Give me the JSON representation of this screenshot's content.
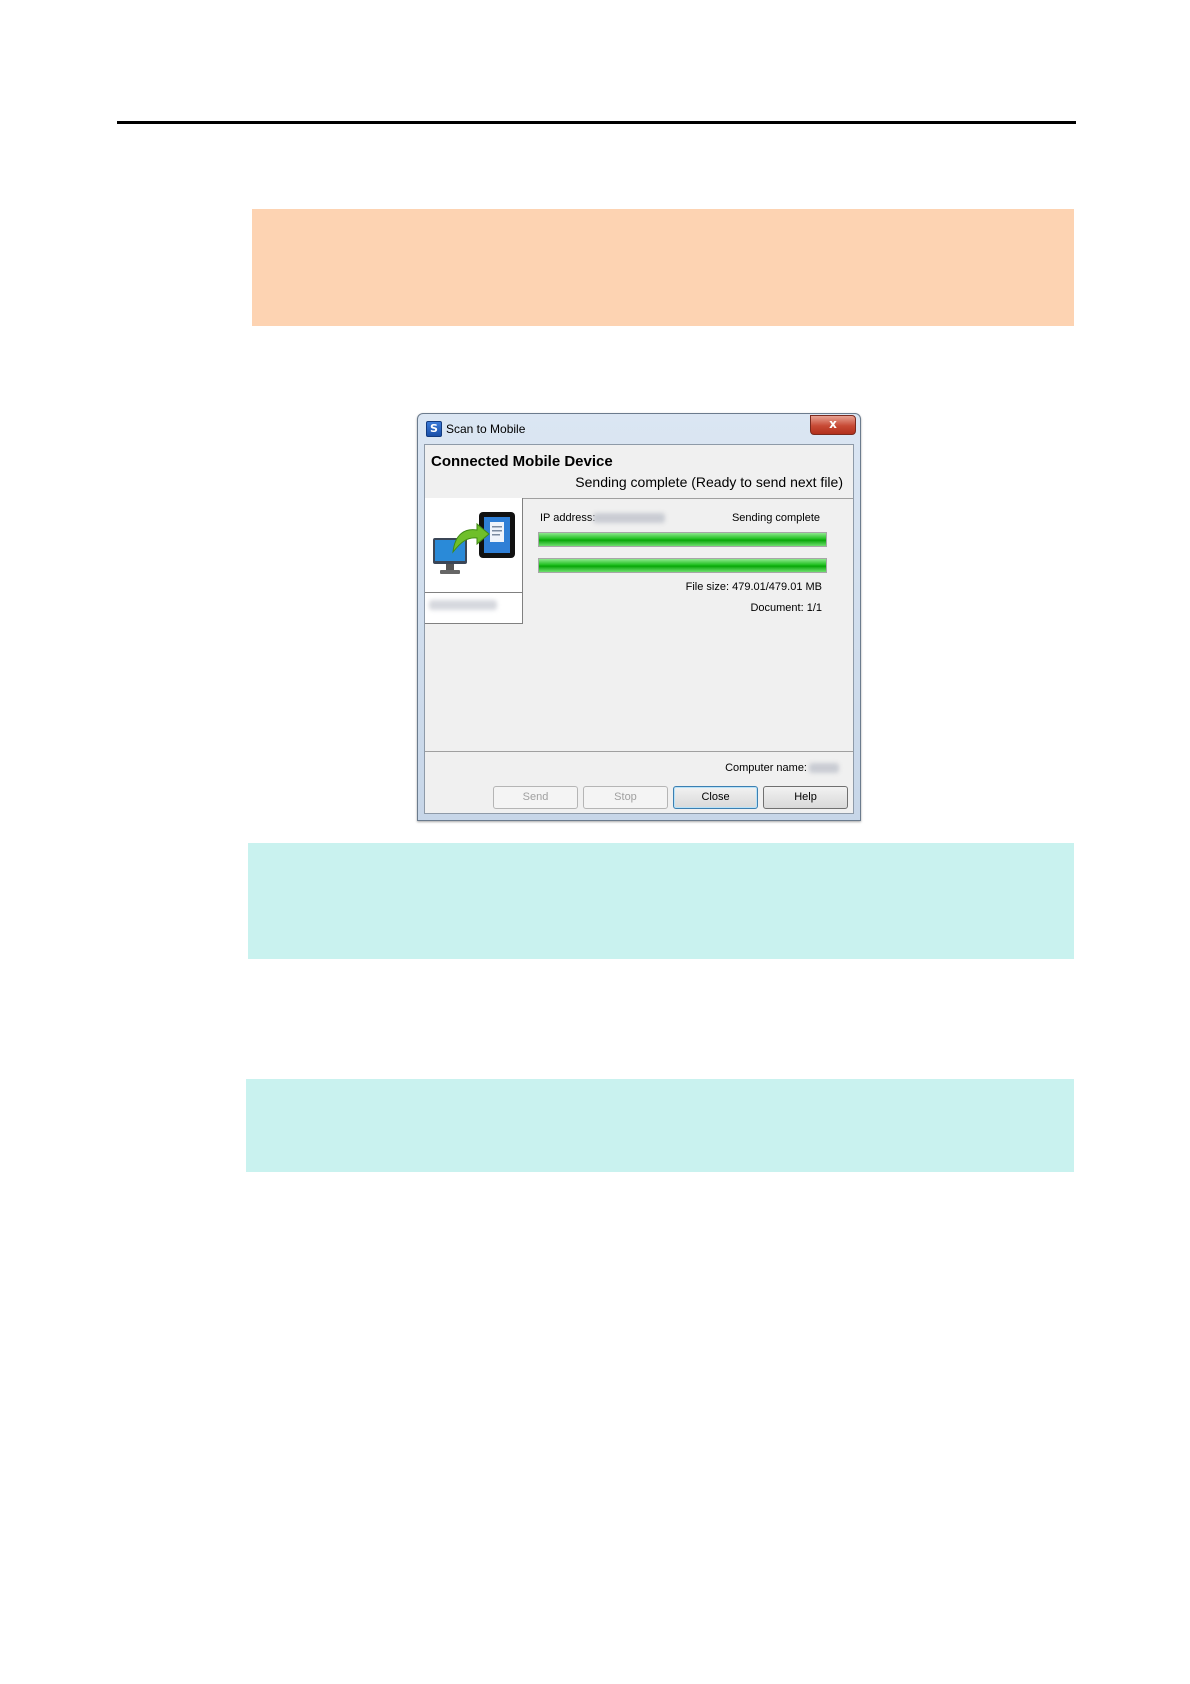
{
  "window": {
    "title": "Scan to Mobile",
    "close_glyph": "x"
  },
  "header": {
    "title": "Connected Mobile Device",
    "status": "Sending complete (Ready to send next file)"
  },
  "device": {
    "icon": "pc-to-mobile-transfer-icon"
  },
  "transfer": {
    "ip_label": "IP address:",
    "status": "Sending complete",
    "progress_file": 1.0,
    "progress_total": 1.0,
    "file_size": "File size: 479.01/479.01 MB",
    "document": "Document: 1/1"
  },
  "footer": {
    "computer_name_label": "Computer name:"
  },
  "buttons": {
    "send": "Send",
    "stop": "Stop",
    "close": "Close",
    "help": "Help"
  },
  "colors": {
    "note_box": "#fdd3b2",
    "hint_box": "#c9f2ef",
    "progress": "#20c020"
  }
}
